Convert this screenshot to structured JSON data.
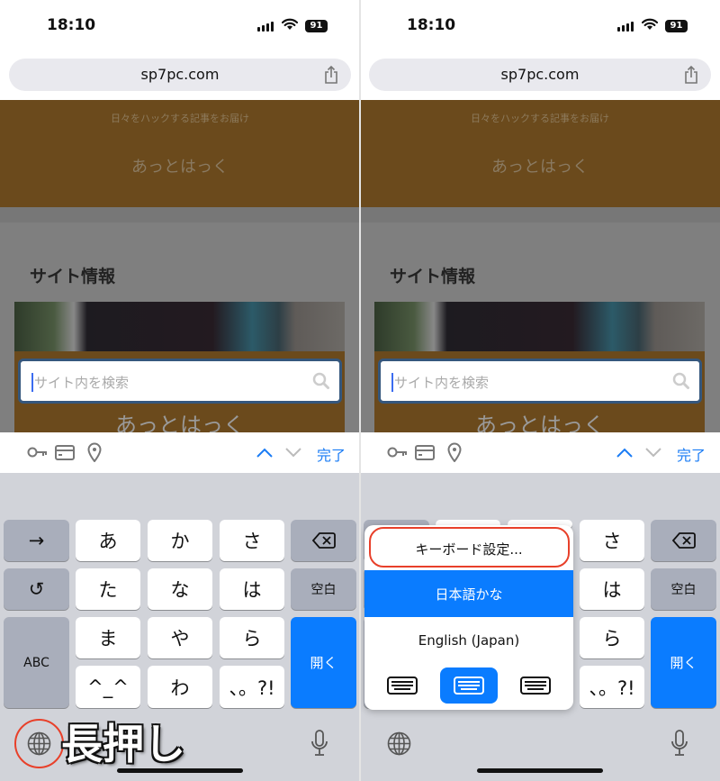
{
  "status": {
    "time": "18:10",
    "battery": "91"
  },
  "browser": {
    "url": "sp7pc.com"
  },
  "site": {
    "tagline": "日々をハックする記事をお届け",
    "brand": "あっとはっく",
    "section_title": "サイト情報",
    "search_placeholder": "サイト内を検索",
    "brand_banner": "あっとはっく"
  },
  "accessory": {
    "done": "完了"
  },
  "keyboard": {
    "keys": [
      [
        "→",
        "あ",
        "か",
        "さ",
        "⌫"
      ],
      [
        "↺",
        "た",
        "な",
        "は",
        "空白"
      ],
      [
        "ABC",
        "ま",
        "や",
        "ら",
        "開く"
      ],
      [
        "^_^",
        "わ",
        "、。?!"
      ]
    ],
    "accent": "#0a7cff"
  },
  "annotation": {
    "long_press": "長押し",
    "highlight_color": "#e8402a"
  },
  "popup": {
    "items": [
      "キーボード設定...",
      "日本語かな",
      "English (Japan)"
    ],
    "selected": "日本語かな"
  }
}
